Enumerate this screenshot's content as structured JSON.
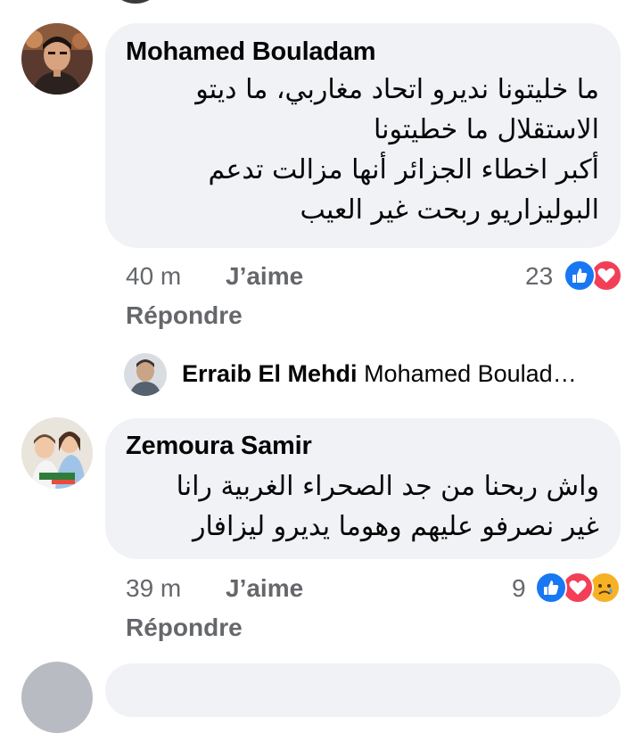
{
  "comments": [
    {
      "author": "Mohamed Bouladam",
      "text_lines": [
        "ما خليتونا نديرو اتحاد مغاربي، ما ديتو",
        "الاستقلال ما خطيتونا",
        "أكبر اخطاء الجزائر أنها مزالت تدعم",
        "البوليزاريو ربحت غير العيب"
      ],
      "time": "40 m",
      "like_label": "J’aime",
      "reply_label": "Répondre",
      "reaction_count": "23",
      "reactions": [
        "like-icon",
        "love-icon"
      ]
    },
    {
      "author": "Zemoura Samir",
      "text_lines": [
        "واش ربحنا من جد الصحراء الغربية رانا",
        "غير نصرفو عليهم وهوما يديرو ليزافار"
      ],
      "time": "39 m",
      "like_label": "J’aime",
      "reply_label": "Répondre",
      "reaction_count": "9",
      "reactions": [
        "like-icon",
        "love-icon",
        "sad-icon"
      ]
    }
  ],
  "reply_preview": {
    "author": "Erraib El Mehdi",
    "text": "Mohamed Boulad…"
  },
  "colors": {
    "bubble": "#f0f2f5",
    "meta_text": "#65676b",
    "like_blue": "#1877f2",
    "love_red": "#f33e58",
    "sad_yellow": "#f7b125"
  }
}
